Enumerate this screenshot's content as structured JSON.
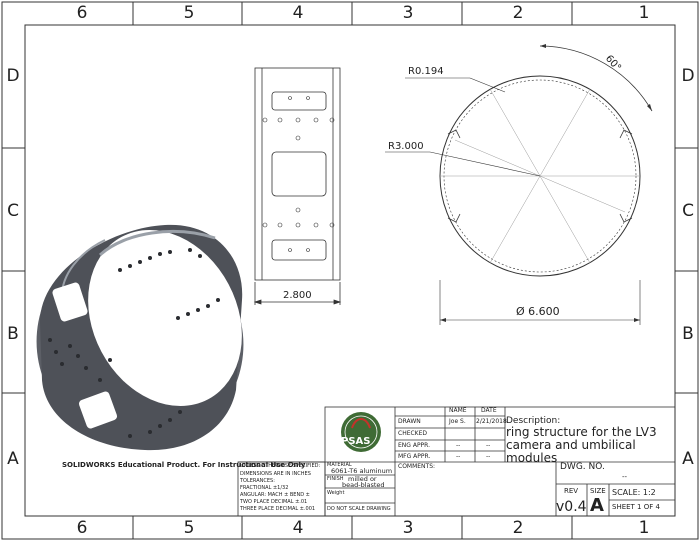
{
  "zones": {
    "columns": [
      "6",
      "5",
      "4",
      "3",
      "2",
      "1"
    ],
    "rows": [
      "D",
      "C",
      "B",
      "A"
    ]
  },
  "dimensions": {
    "fillet_radius": "R0.194",
    "ring_radius": "R3.000",
    "angle": "60°",
    "width": "2.800",
    "diameter": "Ø 6.600"
  },
  "title_block": {
    "header_name": "NAME",
    "header_date": "DATE",
    "drawn_label": "DRAWN",
    "drawn_name": "Joe S.",
    "drawn_date": "2/21/2018",
    "checked_label": "CHECKED",
    "eng_appr_label": "ENG APPR.",
    "mfg_appr_label": "MFG APPR.",
    "dash": "--",
    "description_label": "Description:",
    "description_text": "ring structure for the LV3 camera and umbilical modules",
    "logo_text": "PSAS",
    "comments_label": "COMMENTS:",
    "dwg_no_label": "DWG. NO.",
    "dwg_no_value": "--",
    "rev_label": "REV",
    "rev_value": "v0.4",
    "size_label": "SIZE",
    "size_value": "A",
    "scale_text": "SCALE: 1:2",
    "sheet_text": "SHEET 1 OF 4",
    "unless_label": "UNLESS OTHERWISE SPECIFIED:",
    "dims_note": "DIMENSIONS ARE IN INCHES",
    "tolerances": "TOLERANCES:",
    "fractional": "FRACTIONAL ±1/32",
    "angular": "ANGULAR: MACH ±  BEND ±",
    "two_place": "TWO PLACE DECIMAL  ±.01",
    "three_place": "THREE PLACE DECIMAL ±.001",
    "material_label": "MATERIAL",
    "material_value": "6061-T6 aluminum",
    "finish_label": "FINISH",
    "finish_value_1": "milled or",
    "finish_value_2": "bead-blasted",
    "weight_label": "Weight",
    "do_not_scale": "DO NOT SCALE DRAWING"
  },
  "watermark": "SOLIDWORKS Educational Product. For Instructional Use Only"
}
